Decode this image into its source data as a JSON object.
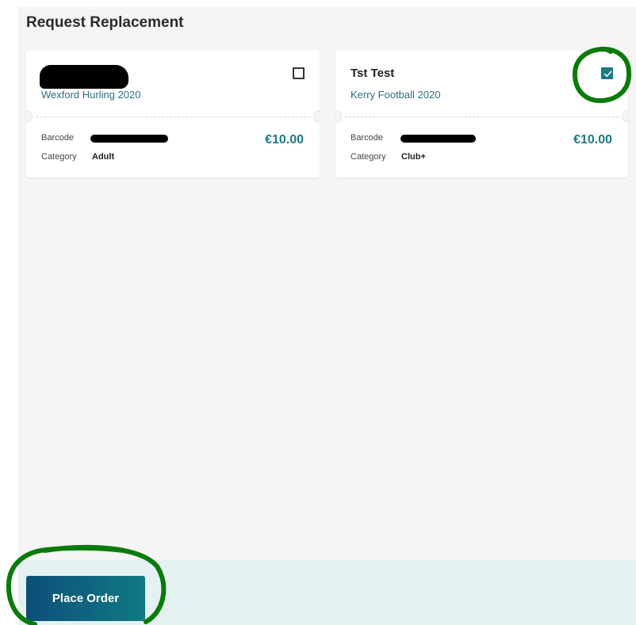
{
  "page": {
    "title": "Request Replacement"
  },
  "tickets": [
    {
      "holder_name": "",
      "membership": "Wexford Hurling 2020",
      "barcode_label": "Barcode",
      "barcode_value": "",
      "category_label": "Category",
      "category_value": "Adult",
      "price": "€10.00",
      "selected": false
    },
    {
      "holder_name": "Tst Test",
      "membership": "Kerry Football 2020",
      "barcode_label": "Barcode",
      "barcode_value": "",
      "category_label": "Category",
      "category_value": "Club+",
      "price": "€10.00",
      "selected": true
    }
  ],
  "footer": {
    "place_order_label": "Place Order"
  },
  "colors": {
    "accent": "#1b7a86",
    "button_start": "#0c4f7a",
    "button_end": "#107a82",
    "annotation": "#0a7a0a"
  },
  "icons": {
    "checkmark": "check-icon"
  }
}
